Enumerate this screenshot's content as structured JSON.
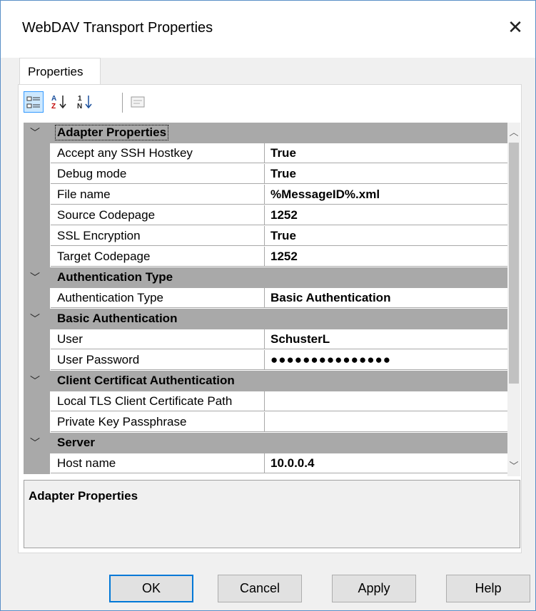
{
  "window": {
    "title": "WebDAV Transport Properties",
    "close_glyph": "✕"
  },
  "tabs": [
    {
      "label": "Properties"
    }
  ],
  "toolbar": {
    "buttons": [
      {
        "icon": "categorized-icon",
        "glyph": "☷",
        "active": true
      },
      {
        "icon": "sort-alphabetical-icon",
        "glyph": "A↓Z"
      },
      {
        "icon": "sort-numeric-icon",
        "glyph": "1↓N"
      },
      {
        "icon": "property-pages-icon",
        "glyph": "▭"
      }
    ]
  },
  "grid": {
    "categories": [
      {
        "label": "Adapter Properties",
        "properties": [
          {
            "name": "Accept any SSH Hostkey",
            "value": "True"
          },
          {
            "name": "Debug mode",
            "value": "True"
          },
          {
            "name": "File name",
            "value": "%MessageID%.xml"
          },
          {
            "name": "Source Codepage",
            "value": "1252"
          },
          {
            "name": "SSL Encryption",
            "value": "True"
          },
          {
            "name": "Target Codepage",
            "value": "1252"
          }
        ]
      },
      {
        "label": "Authentication Type",
        "properties": [
          {
            "name": "Authentication Type",
            "value": "Basic Authentication"
          }
        ]
      },
      {
        "label": "Basic Authentication",
        "properties": [
          {
            "name": "User",
            "value": "SchusterL"
          },
          {
            "name": "User Password",
            "value": "●●●●●●●●●●●●●●●"
          }
        ]
      },
      {
        "label": "Client Certificat Authentication",
        "properties": [
          {
            "name": "Local TLS Client Certificate Path",
            "value": ""
          },
          {
            "name": "Private Key Passphrase",
            "value": ""
          }
        ]
      },
      {
        "label": "Server",
        "properties": [
          {
            "name": "Host name",
            "value": "10.0.0.4"
          }
        ]
      }
    ]
  },
  "description": {
    "title": "Adapter Properties"
  },
  "buttons": {
    "ok": "OK",
    "cancel": "Cancel",
    "apply": "Apply",
    "help": "Help"
  },
  "colors": {
    "category_bg": "#a9a9a9",
    "dialog_bg": "#f0f0f0",
    "focus_border": "#0078d7"
  }
}
